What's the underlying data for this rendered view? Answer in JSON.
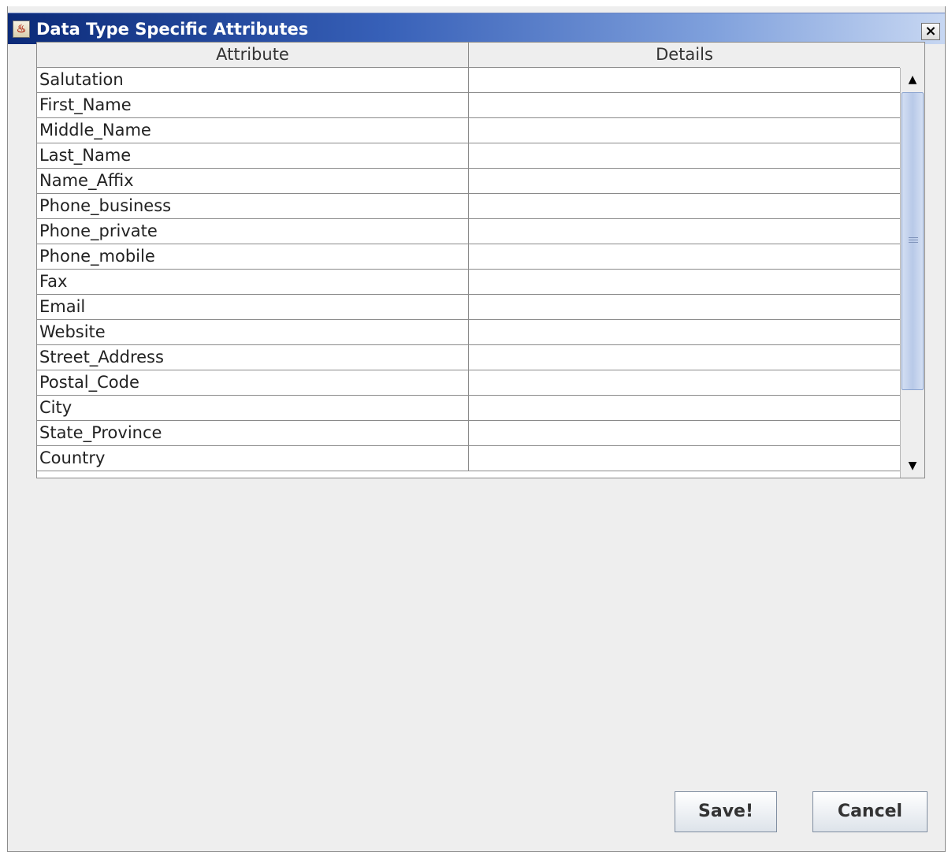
{
  "window": {
    "title": "Data Type Specific Attributes",
    "close_label": "×"
  },
  "table": {
    "columns": [
      "Attribute",
      "Details"
    ],
    "rows": [
      {
        "attribute": "Salutation",
        "details": ""
      },
      {
        "attribute": "First_Name",
        "details": ""
      },
      {
        "attribute": "Middle_Name",
        "details": ""
      },
      {
        "attribute": "Last_Name",
        "details": ""
      },
      {
        "attribute": "Name_Affix",
        "details": ""
      },
      {
        "attribute": "Phone_business",
        "details": ""
      },
      {
        "attribute": "Phone_private",
        "details": ""
      },
      {
        "attribute": "Phone_mobile",
        "details": ""
      },
      {
        "attribute": "Fax",
        "details": ""
      },
      {
        "attribute": "Email",
        "details": ""
      },
      {
        "attribute": "Website",
        "details": ""
      },
      {
        "attribute": "Street_Address",
        "details": ""
      },
      {
        "attribute": "Postal_Code",
        "details": ""
      },
      {
        "attribute": "City",
        "details": ""
      },
      {
        "attribute": "State_Province",
        "details": ""
      },
      {
        "attribute": "Country",
        "details": ""
      }
    ]
  },
  "scrollbar": {
    "up_glyph": "▲",
    "down_glyph": "▼"
  },
  "buttons": {
    "save_label": "Save!",
    "cancel_label": "Cancel"
  }
}
